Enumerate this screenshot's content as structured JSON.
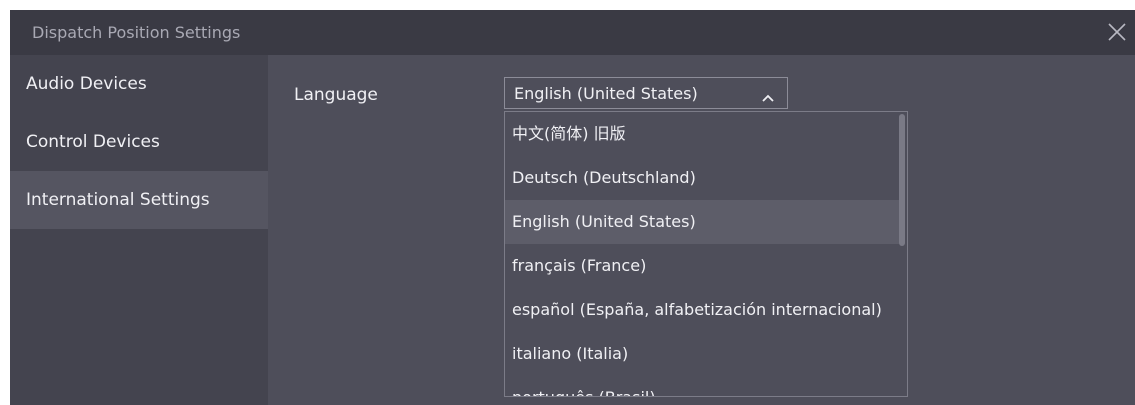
{
  "window": {
    "title": "Dispatch Position Settings",
    "close_icon": "close-icon"
  },
  "sidebar": {
    "items": [
      {
        "label": "Audio Devices",
        "active": false
      },
      {
        "label": "Control Devices",
        "active": false
      },
      {
        "label": "International Settings",
        "active": true
      }
    ]
  },
  "language": {
    "label": "Language",
    "selected": "English (United States)",
    "chevron_icon": "chevron-up-icon",
    "options": [
      {
        "label": "中文(简体) 旧版",
        "highlighted": false
      },
      {
        "label": "Deutsch (Deutschland)",
        "highlighted": false
      },
      {
        "label": "English (United States)",
        "highlighted": true
      },
      {
        "label": "français (France)",
        "highlighted": false
      },
      {
        "label": "español (España, alfabetización internacional)",
        "highlighted": false
      },
      {
        "label": "italiano (Italia)",
        "highlighted": false
      },
      {
        "label": "português (Brasil)",
        "highlighted": false
      }
    ]
  },
  "colors": {
    "background": "#4e4e5a",
    "titlebar": "#3a3a44",
    "sidebar": "#44444f",
    "active_item": "#555561",
    "text": "#f0f0f4"
  }
}
